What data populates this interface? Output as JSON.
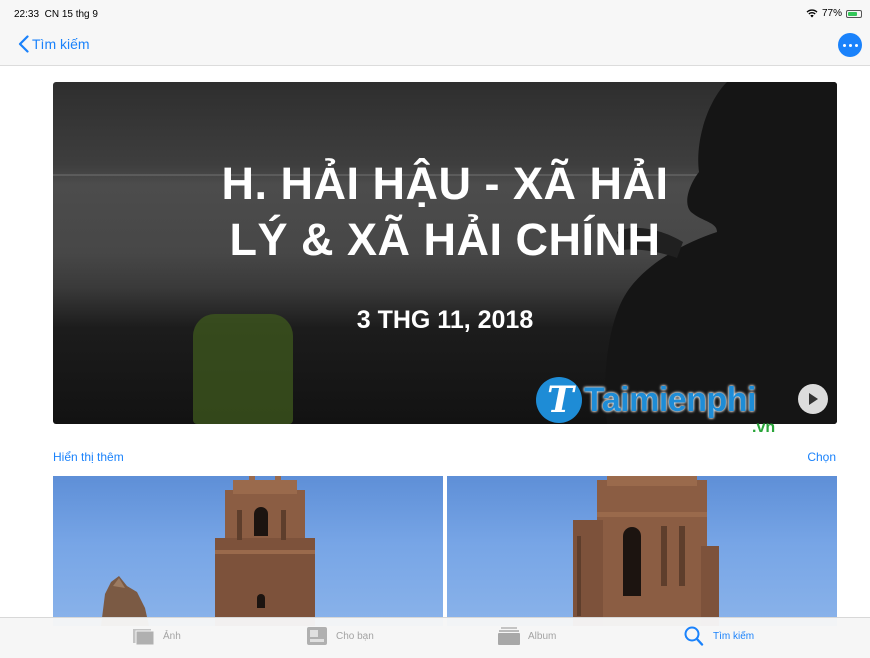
{
  "status_bar": {
    "time": "22:33",
    "date": "CN 15 thg 9",
    "battery": "77%",
    "battery_level": 0.77
  },
  "nav": {
    "back_label": "Tìm kiếm",
    "back_icon": "chevron-left-icon",
    "more_icon": "ellipsis-icon"
  },
  "memory": {
    "title_line1": "H. HẢI HẬU - XÃ HẢI",
    "title_line2": "LÝ & XÃ HẢI CHÍNH",
    "date": "3 THG 11, 2018",
    "play_icon": "play-icon"
  },
  "watermark": {
    "text": "Taimienphi",
    "suffix": ".vn"
  },
  "section": {
    "show_more": "Hiển thị thêm",
    "select": "Chọn"
  },
  "tabs": [
    {
      "label": "Ảnh",
      "icon": "photos-icon",
      "active": false
    },
    {
      "label": "Cho bạn",
      "icon": "for-you-icon",
      "active": false
    },
    {
      "label": "Album",
      "icon": "album-icon",
      "active": false
    },
    {
      "label": "Tìm kiếm",
      "icon": "search-icon",
      "active": true
    }
  ],
  "colors": {
    "accent": "#1a82fb",
    "inactive": "#a3a3a3",
    "watermark_blue": "#1e8cd6",
    "watermark_green": "#2aa53a"
  }
}
